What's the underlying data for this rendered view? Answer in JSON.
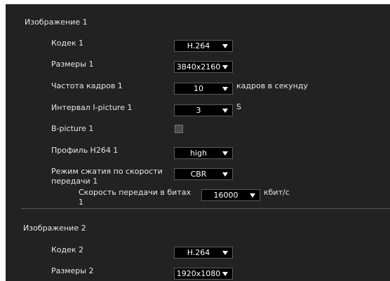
{
  "section1": {
    "title": "Изображение 1",
    "codec": {
      "label": "Кодек 1",
      "value": "H.264"
    },
    "size": {
      "label": "Размеры 1",
      "value": "3840x2160"
    },
    "frame_rate": {
      "label": "Частота кадров 1",
      "value": "10",
      "unit": "кадров в секунду"
    },
    "i_interval": {
      "label": "Интервал I-picture 1",
      "value": "3",
      "unit": "S"
    },
    "b_picture": {
      "label": "B-picture 1",
      "checked": false
    },
    "profile": {
      "label": "Профиль H264 1",
      "value": "high"
    },
    "rate_mode": {
      "label_line1": "Режим сжатия по скорости",
      "label_line2": "передачи 1",
      "value": "CBR"
    },
    "bit_rate": {
      "label_line1": "Скорость передачи в битах",
      "label_line2": "1",
      "value": "16000",
      "unit": "кбит/с"
    }
  },
  "section2": {
    "title": "Изображение 2",
    "codec": {
      "label": "Кодек 2",
      "value": "H.264"
    },
    "size": {
      "label": "Размеры 2",
      "value": "1920x1080"
    }
  }
}
